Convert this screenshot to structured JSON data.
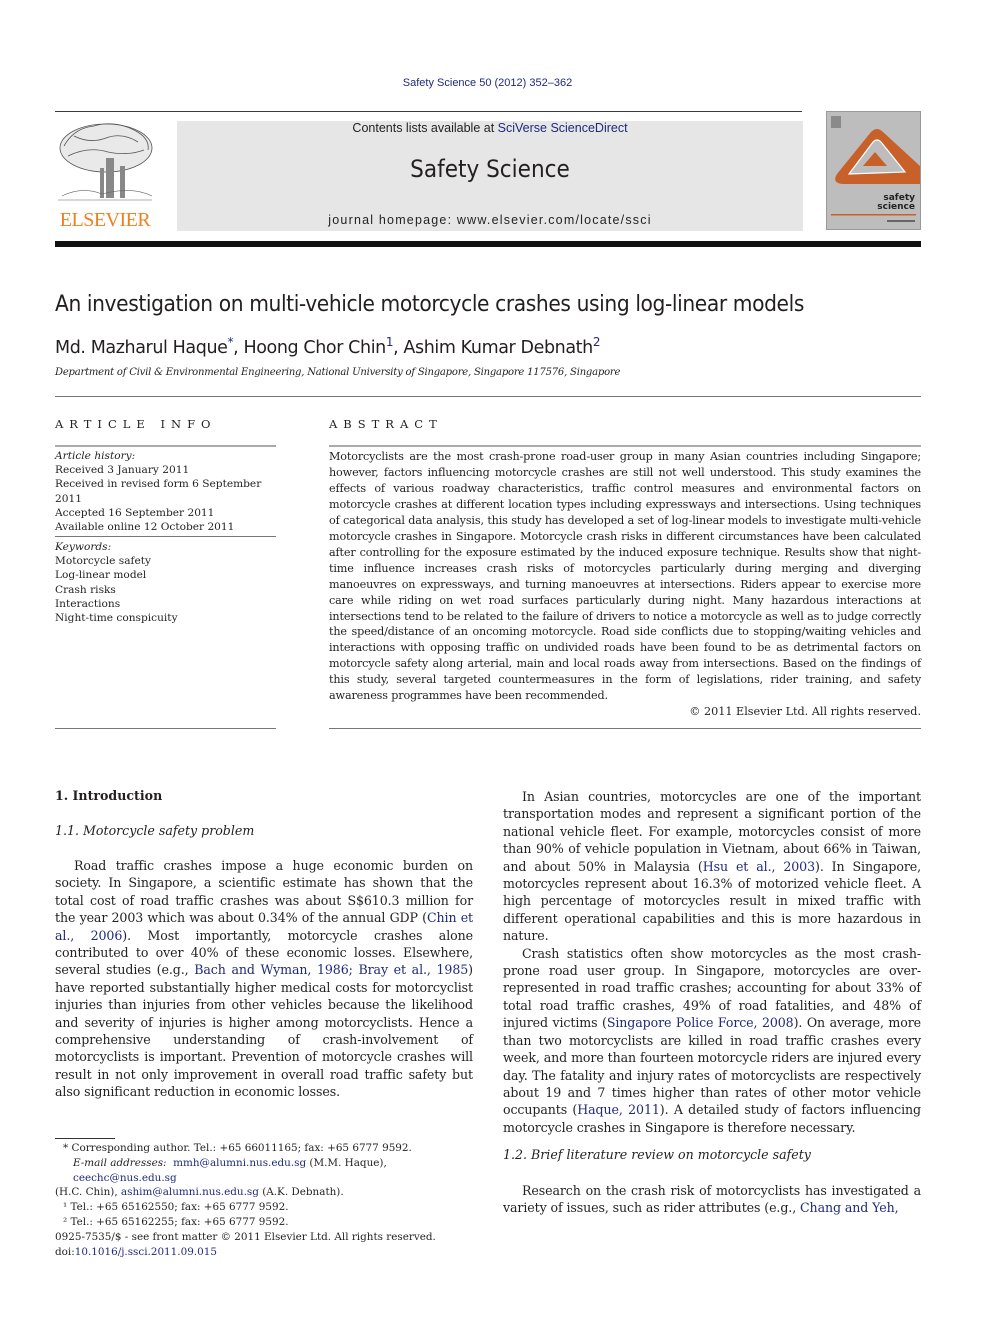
{
  "header": {
    "journal_reference": "Safety Science 50 (2012) 352–362",
    "contents_prefix": "Contents lists available at ",
    "contents_link": "SciVerse ScienceDirect",
    "journal_title": "Safety Science",
    "homepage": "journal homepage: www.elsevier.com/locate/ssci",
    "publisher_logo_text": "ELSEVIER",
    "cover_text_line1": "safety",
    "cover_text_line2": "science",
    "colors": {
      "publisher_orange": "#f07f1e",
      "link_blue": "#1f2a7a",
      "cover_orange": "#c8602a",
      "masthead_gray": "#e6e6e6"
    }
  },
  "article": {
    "title": "An investigation on multi-vehicle motorcycle crashes using log-linear models",
    "authors": [
      {
        "name": "Md. Mazharul Haque",
        "mark": "*"
      },
      {
        "name": "Hoong Chor Chin",
        "mark": "1"
      },
      {
        "name": "Ashim Kumar Debnath",
        "mark": "2"
      }
    ],
    "affiliation": "Department of Civil & Environmental Engineering, National University of Singapore, Singapore 117576, Singapore"
  },
  "article_info": {
    "label": "ARTICLE INFO",
    "history_label": "Article history:",
    "history": [
      "Received 3 January 2011",
      "Received in revised form 6 September 2011",
      "Accepted 16 September 2011",
      "Available online 12 October 2011"
    ],
    "keywords_label": "Keywords:",
    "keywords": [
      "Motorcycle safety",
      "Log-linear model",
      "Crash risks",
      "Interactions",
      "Night-time conspicuity"
    ]
  },
  "abstract": {
    "label": "ABSTRACT",
    "text": "Motorcyclists are the most crash-prone road-user group in many Asian countries including Singapore; however, factors influencing motorcycle crashes are still not well understood. This study examines the effects of various roadway characteristics, traffic control measures and environmental factors on motorcycle crashes at different location types including expressways and intersections. Using techniques of categorical data analysis, this study has developed a set of log-linear models to investigate multi-vehicle motorcycle crashes in Singapore. Motorcycle crash risks in different circumstances have been calculated after controlling for the exposure estimated by the induced exposure technique. Results show that night-time influence increases crash risks of motorcycles particularly during merging and diverging manoeuvres on expressways, and turning manoeuvres at intersections. Riders appear to exercise more care while riding on wet road surfaces particularly during night. Many hazardous interactions at intersections tend to be related to the failure of drivers to notice a motorcycle as well as to judge correctly the speed/distance of an oncoming motorcycle. Road side conflicts due to stopping/waiting vehicles and interactions with opposing traffic on undivided roads have been found to be as detrimental factors on motorcycle safety along arterial, main and local roads away from intersections. Based on the findings of this study, several targeted countermeasures in the form of legislations, rider training, and safety awareness programmes have been recommended.",
    "copyright": "© 2011 Elsevier Ltd. All rights reserved."
  },
  "body": {
    "section1_heading": "1. Introduction",
    "subsection11_heading": "1.1. Motorcycle safety problem",
    "para1": {
      "t1": "Road traffic crashes impose a huge economic burden on society. In Singapore, a scientific estimate has shown that the total cost of road traffic crashes was about S$610.3 million for the year 2003 which was about 0.34% of the annual GDP (",
      "ref1": "Chin et al., 2006",
      "t2": "). Most importantly, motorcycle crashes alone contributed to over 40% of these economic losses. Elsewhere, several studies (e.g., ",
      "ref2": "Bach and Wyman, 1986; Bray et al., 1985",
      "t3": ") have reported substantially higher medical costs for motorcyclist injuries than injuries from other vehicles because the likelihood and severity of injuries is higher among motorcyclists. Hence a comprehensive understanding of crash-involvement of motorcyclists is important. Prevention of motorcycle crashes will result in not only improvement in overall road traffic safety but also significant reduction in economic losses."
    },
    "para2": {
      "t1": "In Asian countries, motorcycles are one of the important transportation modes and represent a significant portion of the national vehicle fleet. For example, motorcycles consist of more than 90% of vehicle population in Vietnam, about 66% in Taiwan, and about 50% in Malaysia (",
      "ref1": "Hsu et al., 2003",
      "t2": "). In Singapore, motorcycles represent about 16.3% of motorized vehicle fleet. A high percentage of motorcycles result in mixed traffic with different operational capabilities and this is more hazardous in nature."
    },
    "para3": {
      "t1": "Crash statistics often show motorcycles as the most crash-prone road user group. In Singapore, motorcycles are over-represented in road traffic crashes; accounting for about 33% of total road traffic crashes, 49% of road fatalities, and 48% of injured victims (",
      "ref1": "Singapore Police Force, 2008",
      "t2": "). On average, more than two motorcyclists are killed in road traffic crashes every week, and more than fourteen motorcycle riders are injured every day. The fatality and injury rates of motorcyclists are respectively about 19 and 7 times higher than rates of other motor vehicle occupants (",
      "ref2": "Haque, 2011",
      "t3": "). A detailed study of factors influencing motorcycle crashes in Singapore is therefore necessary."
    },
    "subsection12_heading": "1.2. Brief literature review on motorcycle safety",
    "para4": {
      "t1": "Research on the crash risk of motorcyclists has investigated a variety of issues, such as rider attributes (e.g., ",
      "ref1": "Chang and Yeh,"
    }
  },
  "footnotes": {
    "corresponding": "* Corresponding author. Tel.: +65 66011165; fax: +65 6777 9592.",
    "email_label": "E-mail addresses:",
    "email1": "mmh@alumni.nus.edu.sg",
    "email1_owner": " (M.M. Haque), ",
    "email2": "ceechc@nus.edu.sg",
    "email2_owner": "(H.C. Chin), ",
    "email3": "ashim@alumni.nus.edu.sg",
    "email3_owner": " (A.K. Debnath).",
    "fn1": "¹ Tel.: +65 65162550; fax: +65 6777 9592.",
    "fn2": "² Tel.: +65 65162255; fax: +65 6777 9592."
  },
  "front_matter": {
    "issn_line": "0925-7535/$ - see front matter © 2011 Elsevier Ltd. All rights reserved.",
    "doi_label": "doi:",
    "doi": "10.1016/j.ssci.2011.09.015"
  }
}
